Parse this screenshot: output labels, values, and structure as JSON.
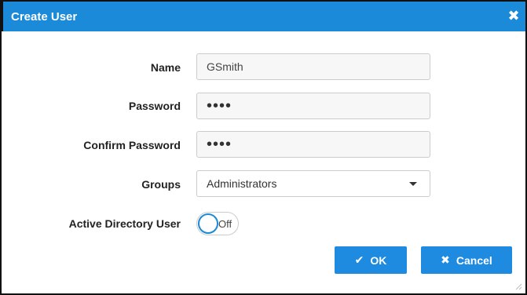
{
  "dialog": {
    "title": "Create User",
    "close_icon": "close-icon"
  },
  "form": {
    "name": {
      "label": "Name",
      "value": "GSmith"
    },
    "password": {
      "label": "Password",
      "value": "••••"
    },
    "confirm_password": {
      "label": "Confirm Password",
      "value": "••••"
    },
    "groups": {
      "label": "Groups",
      "selected": "Administrators"
    },
    "active_directory": {
      "label": "Active Directory User",
      "state": "Off"
    }
  },
  "buttons": {
    "ok_label": "OK",
    "ok_icon": "check-icon",
    "cancel_label": "Cancel",
    "cancel_icon": "x-icon"
  },
  "colors": {
    "titlebar": "#1b8ad8",
    "button": "#1e8be0"
  }
}
